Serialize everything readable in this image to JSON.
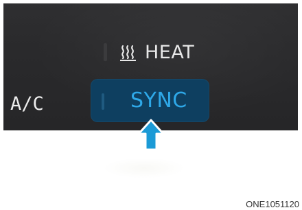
{
  "controls": {
    "heat_label": "HEAT",
    "heat_icon": "seat-heat-icon",
    "ac_label": "A/C",
    "sync_label": "SYNC",
    "pointer_icon": "up-arrow-icon"
  },
  "colors": {
    "panel_bg": "#2a2a2c",
    "sync_bg": "#0e3f60",
    "sync_text": "#2ea8e8",
    "arrow_fill": "#1b9ad6",
    "text_light": "#e8e8e8"
  },
  "figure_code": "ONE1051120"
}
